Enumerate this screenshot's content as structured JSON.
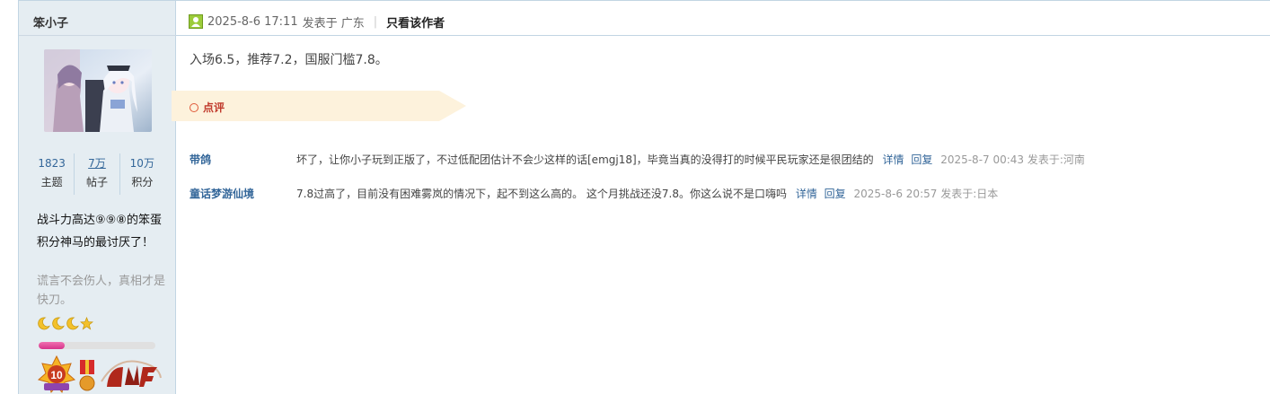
{
  "author": {
    "name": "笨小子",
    "stats": [
      {
        "value": "1823",
        "label": "主题"
      },
      {
        "value": "7万",
        "label": "帖子"
      },
      {
        "value": "10万",
        "label": "积分"
      }
    ],
    "signature": "战斗力高达⑨⑨⑧的笨蛋积分神马的最讨厌了！",
    "motto": "谎言不会伤人，真相才是快刀。",
    "level_progress": 0.22,
    "colors": {
      "accent": "#336699",
      "sidebar_bg": "#e5edf2",
      "level_fill": "#e03c93"
    }
  },
  "post": {
    "date": "2025-8-6 17:11",
    "posted_in": "发表于 广东",
    "only_author": "只看该作者",
    "body": "入场6.5，推荐7.2，国服门槛7.8。"
  },
  "comments_section": {
    "title": "点评",
    "items": [
      {
        "user": "带鸽",
        "text": "坏了，让你小子玩到正版了，不过低配团估计不会少这样的话[emgj18]，毕竟当真的没得打的时候平民玩家还是很团结的",
        "detail": "详情",
        "reply": "回复",
        "time": "2025-8-7 00:43 发表于:河南"
      },
      {
        "user": "童话梦游仙境",
        "text": "7.8过高了，目前没有困难雾岚的情况下，起不到这么高的。 这个月挑战还没7.8。你这么说不是口嗨吗",
        "detail": "详情",
        "reply": "回复",
        "time": "2025-8-6 20:57 发表于:日本"
      }
    ]
  }
}
